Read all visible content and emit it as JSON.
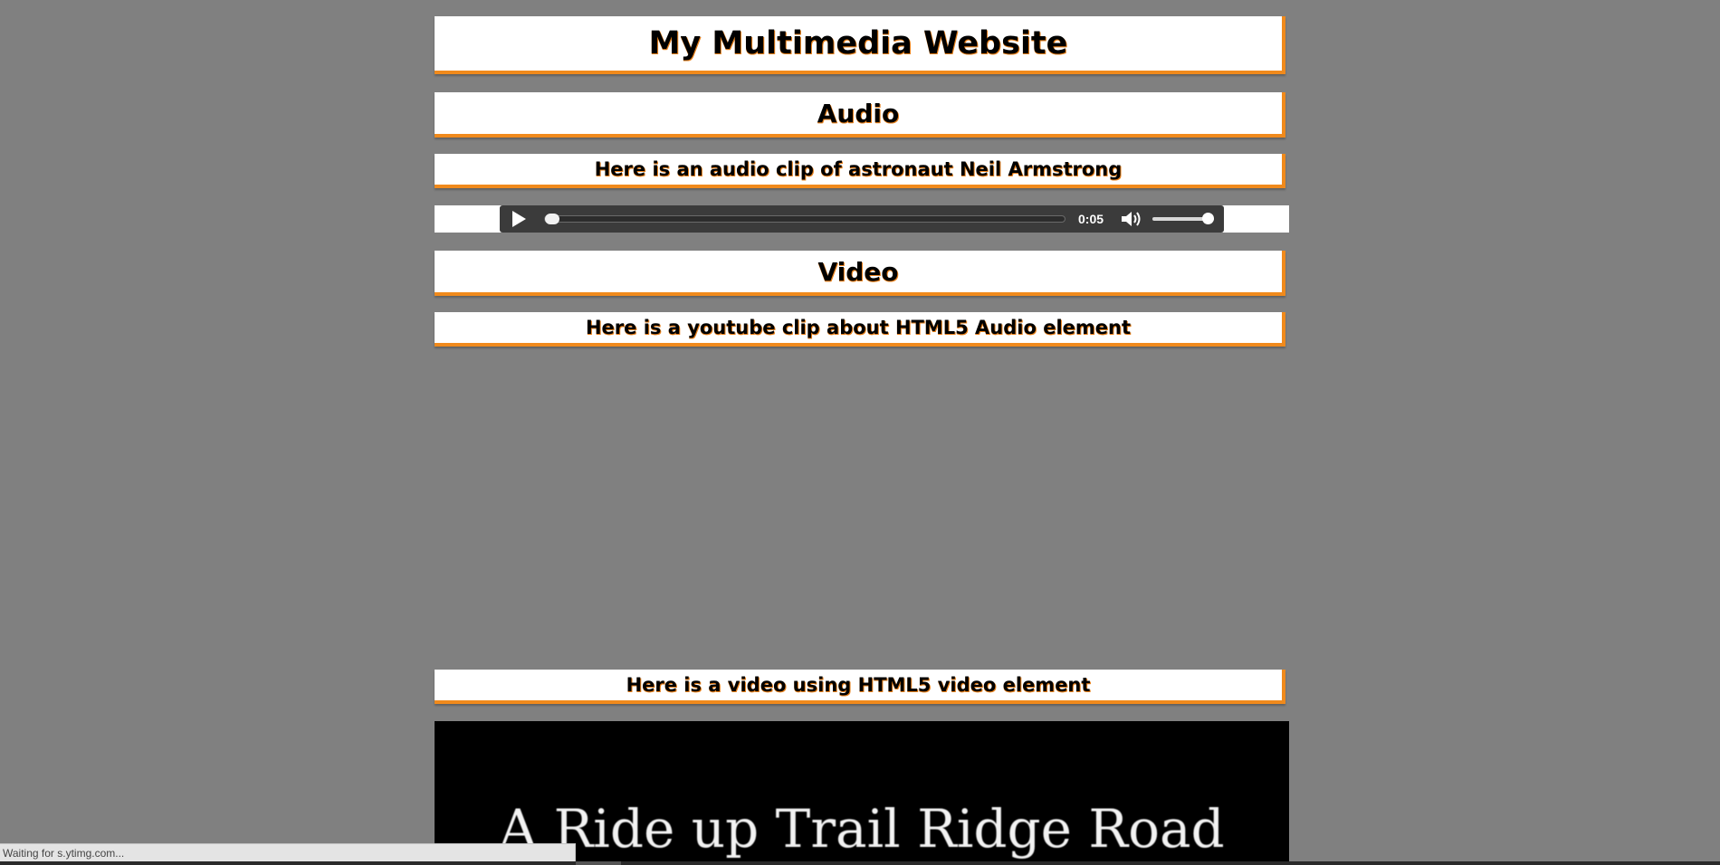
{
  "page": {
    "background_color": "#808080",
    "accent_color": "#f08a1c"
  },
  "header": {
    "title": "My Multimedia Website"
  },
  "audio_section": {
    "heading": "Audio",
    "caption": "Here is an audio clip of astronaut Neil Armstrong",
    "player": {
      "time": "0:05",
      "progress_fraction": 0.0,
      "volume_fraction": 1.0
    }
  },
  "video_section": {
    "heading": "Video",
    "youtube_caption": "Here is a youtube clip about HTML5 Audio element",
    "html5_caption": "Here is a video using HTML5 video element",
    "video_frame_text": "A Ride up Trail Ridge Road"
  },
  "status_bar": {
    "text": "Waiting for s.ytimg.com..."
  }
}
